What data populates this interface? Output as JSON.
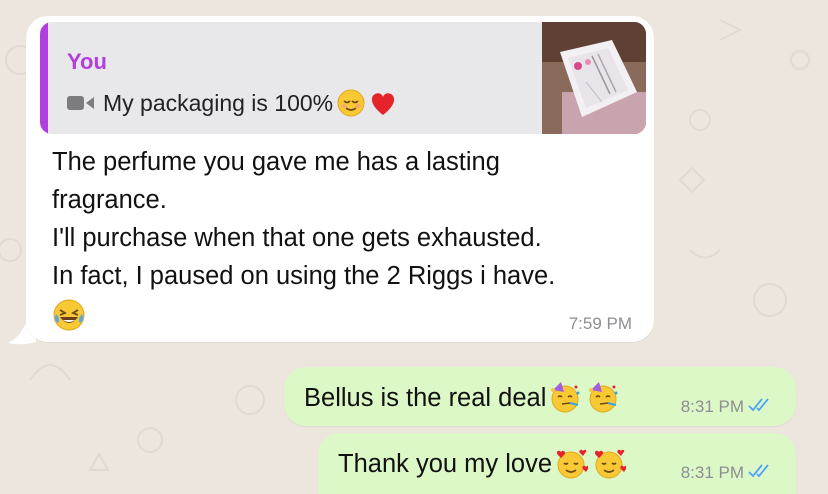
{
  "incoming": {
    "quote": {
      "author": "You",
      "icon": "video-camera-icon",
      "text": "My packaging is 100%",
      "emojis": [
        "relieved-face",
        "red-heart"
      ]
    },
    "lines": [
      "The perfume you gave me has a lasting",
      "fragrance.",
      "I'll purchase when that one gets exhausted.",
      "In fact, I paused on using the 2 Riggs i have."
    ],
    "trailing_emoji": "face-with-tears-of-joy",
    "time": "7:59 PM"
  },
  "outgoing": [
    {
      "text": "Bellus is the real deal",
      "emojis": [
        "partying-face",
        "partying-face"
      ],
      "time": "8:31 PM",
      "status": "read-double-check"
    },
    {
      "text": "Thank you my love",
      "emojis": [
        "smiling-face-with-hearts",
        "smiling-face-with-hearts"
      ],
      "time": "8:31 PM",
      "status": "read-double-check"
    }
  ],
  "colors": {
    "background": "#ece6df",
    "incoming_bubble": "#ffffff",
    "outgoing_bubble": "#dcf8c6",
    "quote_accent": "#b13fe0",
    "read_ticks": "#4fa3f7"
  }
}
